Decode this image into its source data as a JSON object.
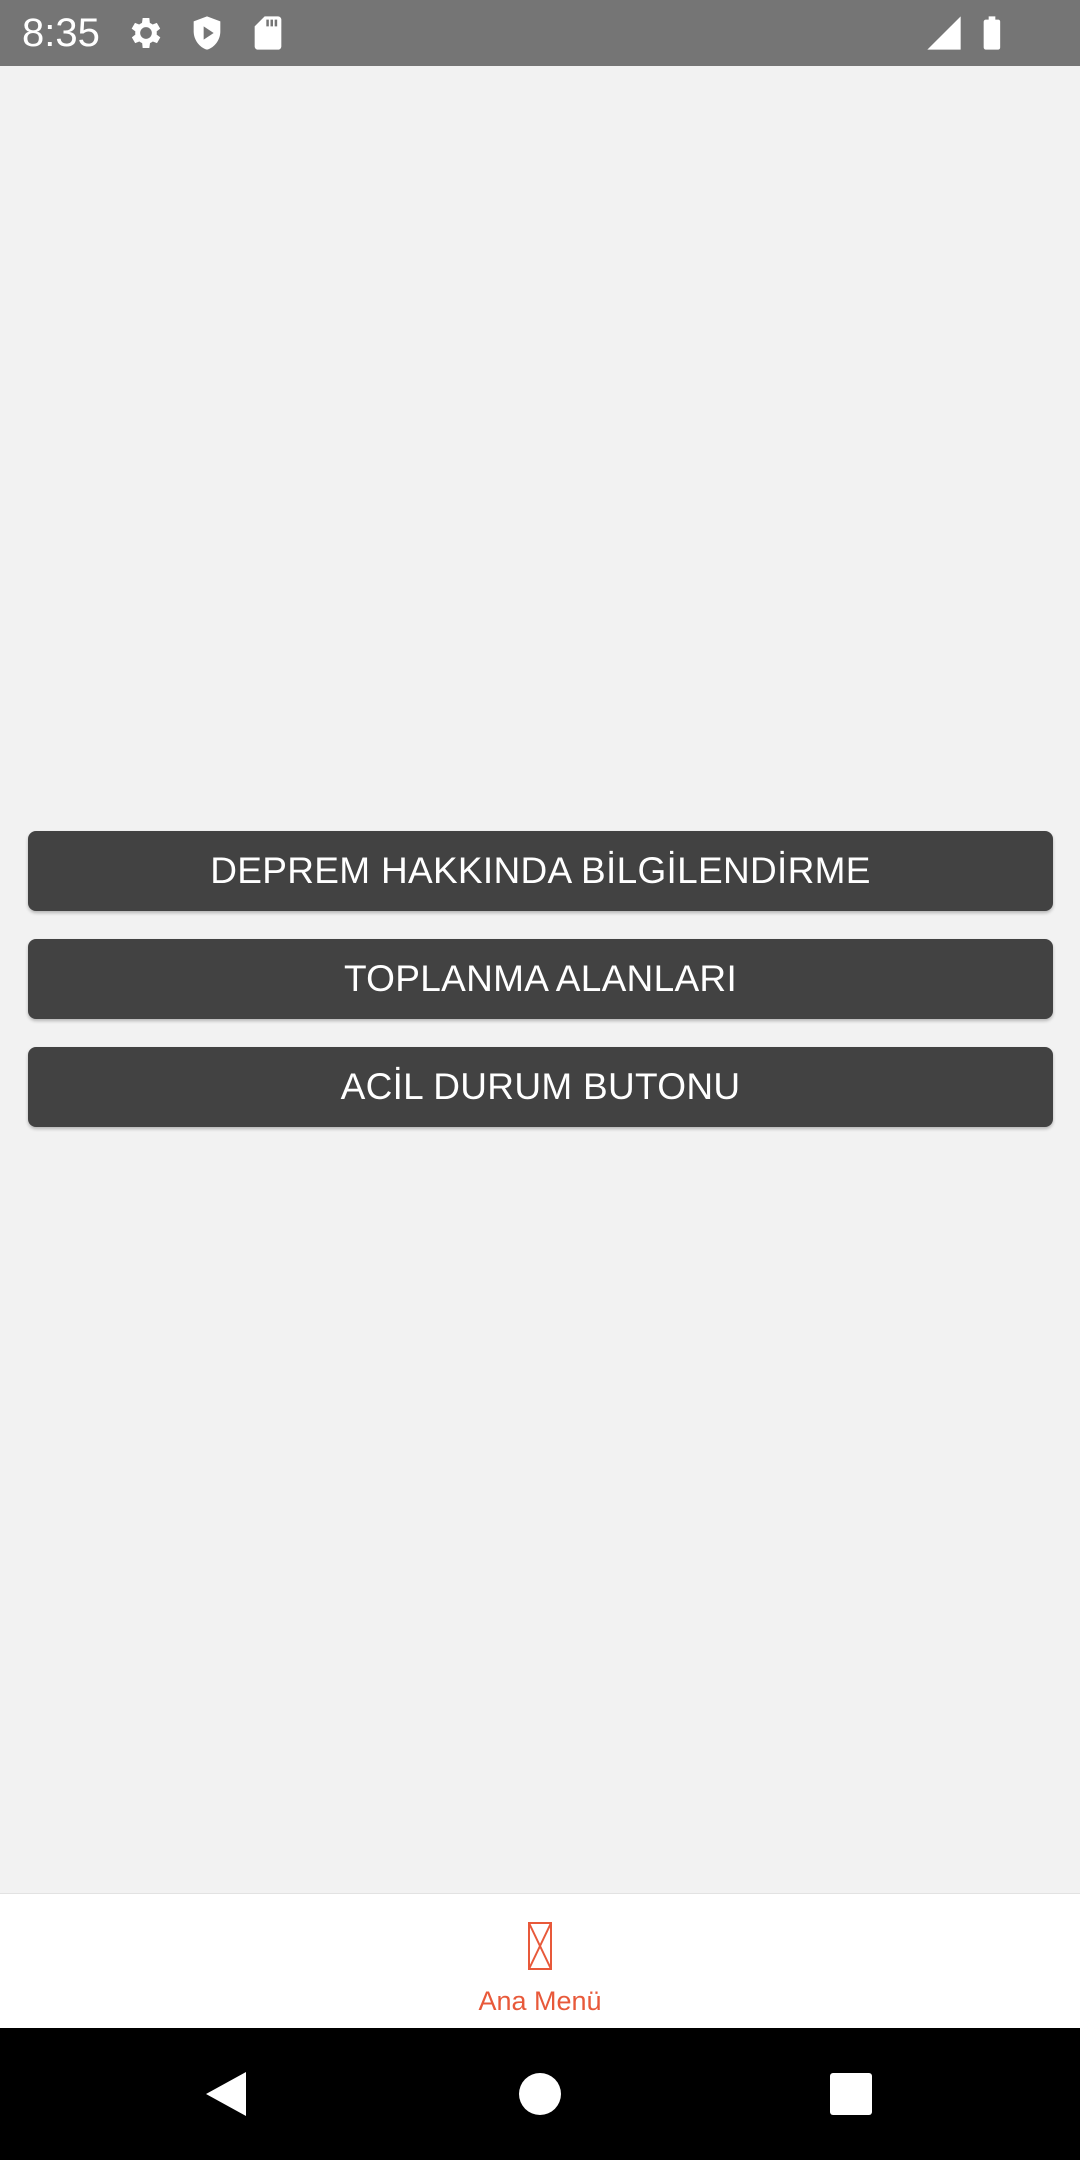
{
  "status_bar": {
    "time": "8:35",
    "icons": [
      "gear-icon",
      "shield-play-icon",
      "sd-card-icon",
      "signal-icon",
      "battery-icon"
    ]
  },
  "main": {
    "buttons": [
      {
        "label": "DEPREM HAKKINDA BİLGİLENDİRME"
      },
      {
        "label": "TOPLANMA ALANLARI"
      },
      {
        "label": "ACİL DURUM BUTONU"
      }
    ]
  },
  "tab_bar": {
    "items": [
      {
        "label": "Ana Menü",
        "icon": "missing-glyph-icon",
        "active": true
      }
    ]
  },
  "nav_bar": {
    "buttons": [
      "back-icon",
      "home-icon",
      "recents-icon"
    ]
  },
  "colors": {
    "status_bar": "#757575",
    "background": "#f2f2f2",
    "button": "#424242",
    "button_text": "#ffffff",
    "accent": "#e8593a",
    "nav_bar": "#000000"
  }
}
